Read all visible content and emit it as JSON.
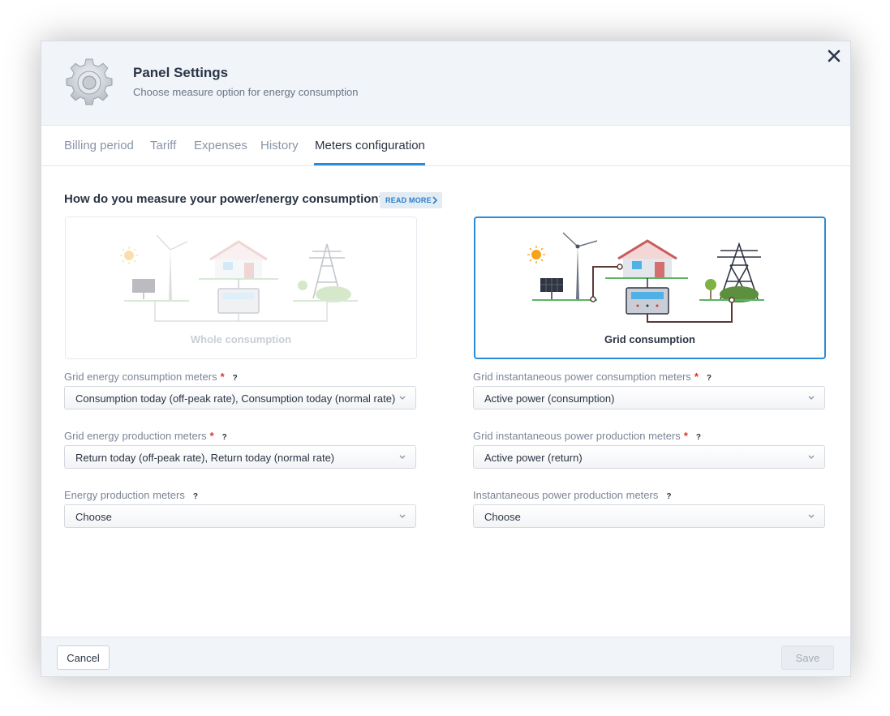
{
  "header": {
    "title": "Panel Settings",
    "subtitle": "Choose measure option for energy consumption"
  },
  "tabs": [
    {
      "label": "Billing period",
      "active": false
    },
    {
      "label": "Tariff",
      "active": false
    },
    {
      "label": "Expenses",
      "active": false
    },
    {
      "label": "History",
      "active": false
    },
    {
      "label": "Meters configuration",
      "active": true
    }
  ],
  "question": "How do you measure your power/energy consumption?",
  "read_more": "READ MORE",
  "options": [
    {
      "label": "Whole consumption",
      "selected": false
    },
    {
      "label": "Grid consumption",
      "selected": true
    }
  ],
  "fields": {
    "left": [
      {
        "label": "Grid energy consumption meters",
        "required": true,
        "help": "?",
        "value": "Consumption today (off-peak rate), Consumption today (normal rate)"
      },
      {
        "label": "Grid energy production meters",
        "required": true,
        "help": "?",
        "value": "Return today (off-peak rate), Return today (normal rate)"
      },
      {
        "label": "Energy production meters",
        "required": false,
        "help": "?",
        "value": "Choose"
      }
    ],
    "right": [
      {
        "label": "Grid instantaneous power consumption meters",
        "required": true,
        "help": "?",
        "value": "Active power (consumption)"
      },
      {
        "label": "Grid instantaneous power production meters",
        "required": true,
        "help": "?",
        "value": "Active power (return)"
      },
      {
        "label": "Instantaneous power production meters",
        "required": false,
        "help": "?",
        "value": "Choose"
      }
    ],
    "required_mark": "*"
  },
  "footer": {
    "cancel_label": "Cancel",
    "save_label": "Save"
  },
  "colors": {
    "accent": "#2a8bd8",
    "required": "#e0342a"
  },
  "icons": [
    "settings-gear-icon",
    "close-icon",
    "chevron-right-icon",
    "chevron-down-icon"
  ]
}
